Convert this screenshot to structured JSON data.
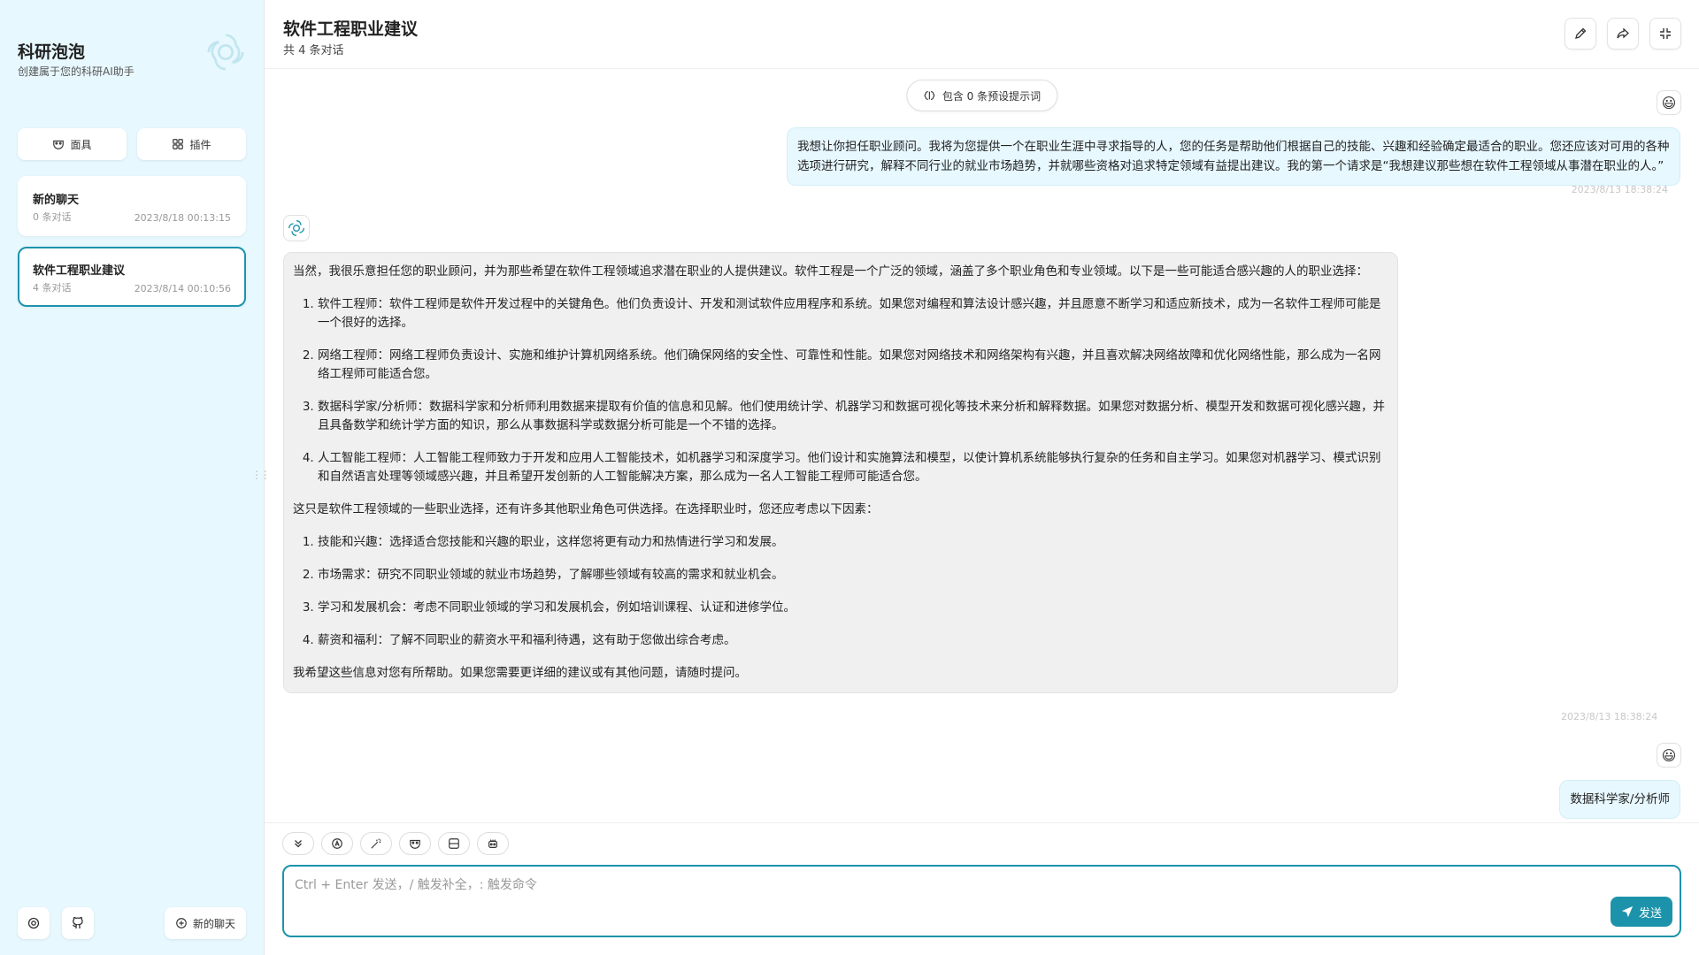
{
  "sidebar": {
    "title": "科研泡泡",
    "subtitle": "创建属于您的科研AI助手",
    "mask_label": "面具",
    "plugin_label": "插件",
    "chats": [
      {
        "title": "新的聊天",
        "count": "0 条对话",
        "date": "2023/8/18 00:13:15",
        "selected": false
      },
      {
        "title": "软件工程职业建议",
        "count": "4 条对话",
        "date": "2023/8/14 00:10:56",
        "selected": true
      }
    ],
    "new_chat_label": "新的聊天"
  },
  "header": {
    "title": "软件工程职业建议",
    "subtitle": "共 4 条对话"
  },
  "prompt_pill": "包含 0 条预设提示词",
  "messages": {
    "user1": {
      "avatar": "😃",
      "text": "我想让你担任职业顾问。我将为您提供一个在职业生涯中寻求指导的人，您的任务是帮助他们根据自己的技能、兴趣和经验确定最适合的职业。您还应该对可用的各种选项进行研究，解释不同行业的就业市场趋势，并就哪些资格对追求特定领域有益提出建议。我的第一个请求是“我想建议那些想在软件工程领域从事潜在职业的人。”",
      "time": "2023/8/13 18:38:24"
    },
    "bot1": {
      "intro": "当然，我很乐意担任您的职业顾问，并为那些希望在软件工程领域追求潜在职业的人提供建议。软件工程是一个广泛的领域，涵盖了多个职业角色和专业领域。以下是一些可能适合感兴趣的人的职业选择：",
      "roles": [
        "软件工程师：软件工程师是软件开发过程中的关键角色。他们负责设计、开发和测试软件应用程序和系统。如果您对编程和算法设计感兴趣，并且愿意不断学习和适应新技术，成为一名软件工程师可能是一个很好的选择。",
        "网络工程师：网络工程师负责设计、实施和维护计算机网络系统。他们确保网络的安全性、可靠性和性能。如果您对网络技术和网络架构有兴趣，并且喜欢解决网络故障和优化网络性能，那么成为一名网络工程师可能适合您。",
        "数据科学家/分析师：数据科学家和分析师利用数据来提取有价值的信息和见解。他们使用统计学、机器学习和数据可视化等技术来分析和解释数据。如果您对数据分析、模型开发和数据可视化感兴趣，并且具备数学和统计学方面的知识，那么从事数据科学或数据分析可能是一个不错的选择。",
        "人工智能工程师：人工智能工程师致力于开发和应用人工智能技术，如机器学习和深度学习。他们设计和实施算法和模型，以使计算机系统能够执行复杂的任务和自主学习。如果您对机器学习、模式识别和自然语言处理等领域感兴趣，并且希望开发创新的人工智能解决方案，那么成为一名人工智能工程师可能适合您。"
      ],
      "middle": "这只是软件工程领域的一些职业选择，还有许多其他职业角色可供选择。在选择职业时，您还应考虑以下因素：",
      "factors": [
        "技能和兴趣：选择适合您技能和兴趣的职业，这样您将更有动力和热情进行学习和发展。",
        "市场需求：研究不同职业领域的就业市场趋势，了解哪些领域有较高的需求和就业机会。",
        "学习和发展机会：考虑不同职业领域的学习和发展机会，例如培训课程、认证和进修学位。",
        "薪资和福利：了解不同职业的薪资水平和福利待遇，这有助于您做出综合考虑。"
      ],
      "outro": "我希望这些信息对您有所帮助。如果您需要更详细的建议或有其他问题，请随时提问。",
      "time": "2023/8/13 18:38:24"
    },
    "user2": {
      "avatar": "😃",
      "text": "数据科学家/分析师"
    }
  },
  "composer": {
    "placeholder": "Ctrl + Enter 发送，/ 触发补全，: 触发命令",
    "send_label": "发送"
  },
  "colors": {
    "accent": "#1d93ab",
    "sidebar_bg": "#e7f8ff",
    "user_bubble": "#e7f8ff",
    "bot_bubble": "#f0f0f0"
  }
}
